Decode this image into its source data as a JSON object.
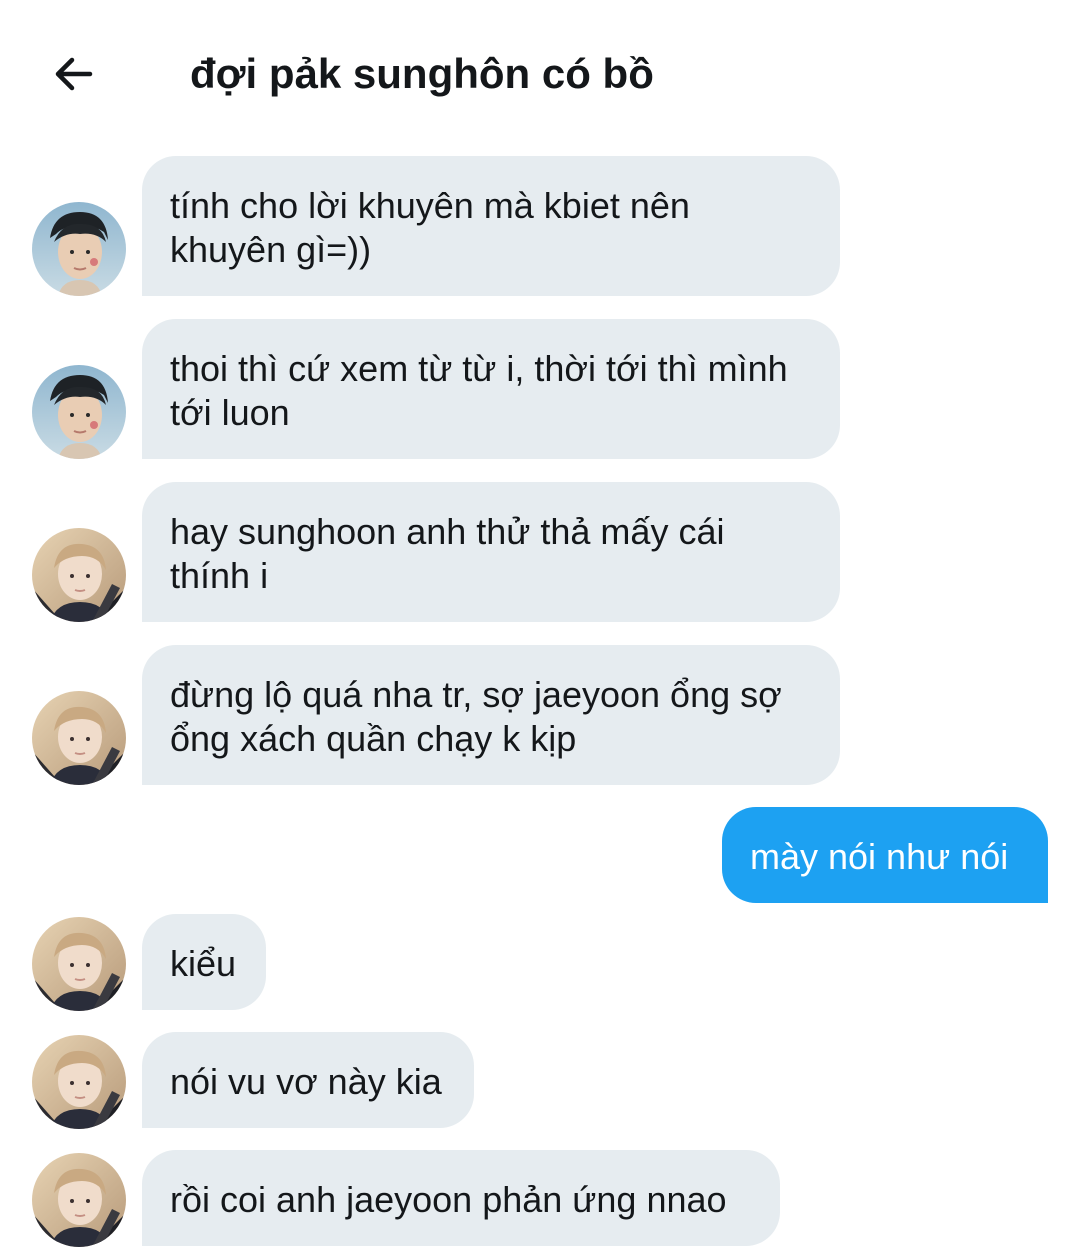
{
  "header": {
    "title": "đợi pảk sunghôn có bồ"
  },
  "messages": [
    {
      "text": "tính cho lời khuyên mà kbiet nên khuyên gì=))",
      "from": "other",
      "avatar": "avatar-dark-hair"
    },
    {
      "text": "thoi thì cứ xem từ từ i, thời tới thì mình tới luon",
      "from": "other",
      "avatar": "avatar-dark-hair"
    },
    {
      "text": "hay sunghoon anh thử thả mấy cái thính i",
      "from": "other",
      "avatar": "avatar-light-hair"
    },
    {
      "text": "đừng lộ quá nha tr, sợ jaeyoon ổng sợ ổng xách quần chạy k kịp",
      "from": "other",
      "avatar": "avatar-light-hair"
    },
    {
      "text": "mày nói như nói",
      "from": "me"
    },
    {
      "text": "kiểu",
      "from": "other",
      "avatar": "avatar-light-hair"
    },
    {
      "text": "nói vu vơ này kia",
      "from": "other",
      "avatar": "avatar-light-hair"
    },
    {
      "text": "rồi coi anh jaeyoon phản ứng nnao",
      "from": "other",
      "avatar": "avatar-light-hair"
    }
  ],
  "colors": {
    "bubble_other": "#e6ecf0",
    "bubble_me": "#1da1f2",
    "text": "#14171a"
  }
}
